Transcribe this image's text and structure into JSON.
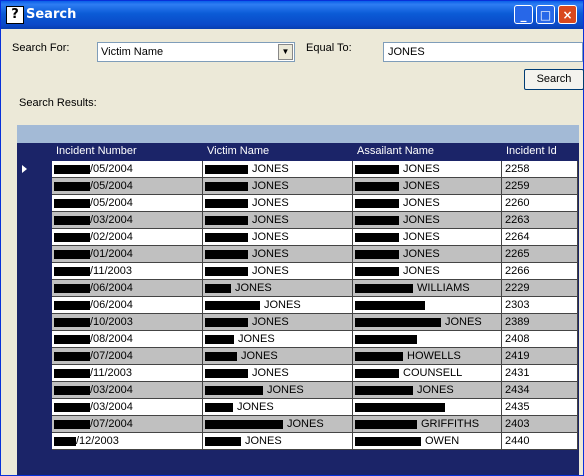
{
  "window": {
    "title": "Search",
    "icon": "help-icon"
  },
  "form": {
    "search_for_label": "Search For:",
    "search_for_value": "Victim Name",
    "equal_to_label": "Equal To:",
    "equal_to_value": "JONES",
    "search_button": "Search",
    "results_label": "Search Results:"
  },
  "grid": {
    "columns": [
      "Incident Number",
      "Victim Name",
      "Assailant Name",
      "Incident Id"
    ],
    "rows": [
      {
        "incident_number": "/05/2004",
        "victim": "JONES",
        "assailant": "JONES",
        "id": "2258",
        "selected": true
      },
      {
        "incident_number": "/05/2004",
        "victim": "JONES",
        "assailant": "JONES",
        "id": "2259"
      },
      {
        "incident_number": "/05/2004",
        "victim": "JONES",
        "assailant": "JONES",
        "id": "2260"
      },
      {
        "incident_number": "/03/2004",
        "victim": "JONES",
        "assailant": "JONES",
        "id": "2263"
      },
      {
        "incident_number": "/02/2004",
        "victim": "JONES",
        "assailant": "JONES",
        "id": "2264"
      },
      {
        "incident_number": "/01/2004",
        "victim": "JONES",
        "assailant": "JONES",
        "id": "2265"
      },
      {
        "incident_number": "/11/2003",
        "victim": "JONES",
        "assailant": "JONES",
        "id": "2266"
      },
      {
        "incident_number": "/06/2004",
        "victim": "JONES",
        "assailant": "WILLIAMS",
        "id": "2229"
      },
      {
        "incident_number": "/06/2004",
        "victim": "JONES",
        "assailant": "",
        "id": "2303"
      },
      {
        "incident_number": "/10/2003",
        "victim": "JONES",
        "assailant": "JONES",
        "id": "2389"
      },
      {
        "incident_number": "/08/2004",
        "victim": "JONES",
        "assailant": "",
        "id": "2408"
      },
      {
        "incident_number": "/07/2004",
        "victim": "JONES",
        "assailant": "HOWELLS",
        "id": "2419"
      },
      {
        "incident_number": "/11/2003",
        "victim": "JONES",
        "assailant": "COUNSELL",
        "id": "2431"
      },
      {
        "incident_number": "/03/2004",
        "victim": "JONES",
        "assailant": "JONES",
        "id": "2434"
      },
      {
        "incident_number": "/03/2004",
        "victim": "JONES",
        "assailant": "",
        "id": "2435"
      },
      {
        "incident_number": "/07/2004",
        "victim": "JONES",
        "assailant": "GRIFFITHS",
        "id": "2403"
      },
      {
        "incident_number": "/12/2003",
        "victim": "JONES",
        "assailant": "OWEN",
        "id": "2440"
      }
    ]
  },
  "colors": {
    "title_bar": "#0a5fe8",
    "grid_body": "#1b2468",
    "row_odd": "#ffffff",
    "row_even": "#c0c0c0",
    "grid_caption": "#a3bad6"
  }
}
